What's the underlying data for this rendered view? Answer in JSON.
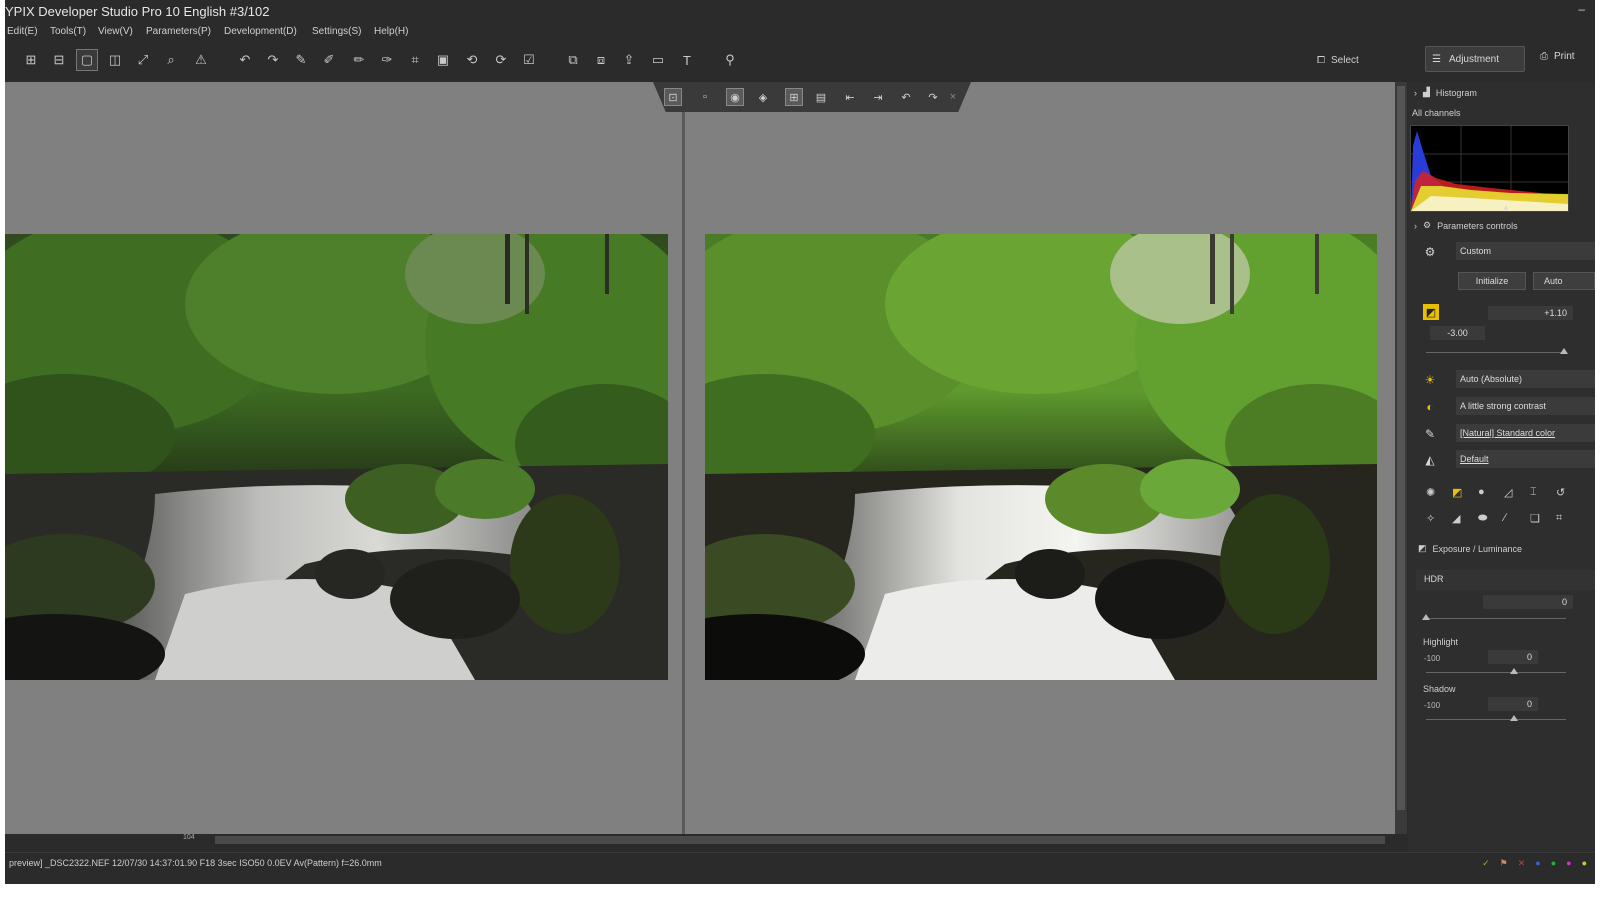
{
  "app": {
    "title": "YPIX Developer Studio Pro 10 English   #3/102",
    "minimize": "–"
  },
  "menu": [
    "Edit(E)",
    "Tools(T)",
    "View(V)",
    "Parameters(P)",
    "Development(D)",
    "Settings(S)",
    "Help(H)"
  ],
  "toolbar": {
    "select_label": "Select",
    "adjustment_label": "Adjustment",
    "print_label": "Print"
  },
  "viewer": {
    "zoom_label": "104"
  },
  "statusbar": {
    "text": "preview] _DSC2322.NEF 12/07/30 14:37:01.90 F18 3sec ISO50 0.0EV Av(Pattern) f=26.0mm"
  },
  "panel": {
    "histogram_title": "Histogram",
    "channel": "All channels",
    "parameters_title": "Parameters controls",
    "preset": "Custom",
    "initialize": "Initialize",
    "auto": "Auto",
    "exposure_value": "+1.10",
    "exposure_min": "-3.00",
    "wb": "Auto (Absolute)",
    "contrast": "A little strong contrast",
    "color": "[Natural] Standard color",
    "sharpness": "Default",
    "exposure_section": "Exposure / Luminance",
    "hdr_label": "HDR",
    "hdr_value": "0",
    "highlight_label": "Highlight",
    "highlight_min": "-100",
    "highlight_value": "0",
    "shadow_label": "Shadow",
    "shadow_min": "-100",
    "shadow_value": "0"
  },
  "colors": {
    "background": "#2b2b2b",
    "viewer_gray": "#808080",
    "accent_yellow": "#e8c000"
  }
}
